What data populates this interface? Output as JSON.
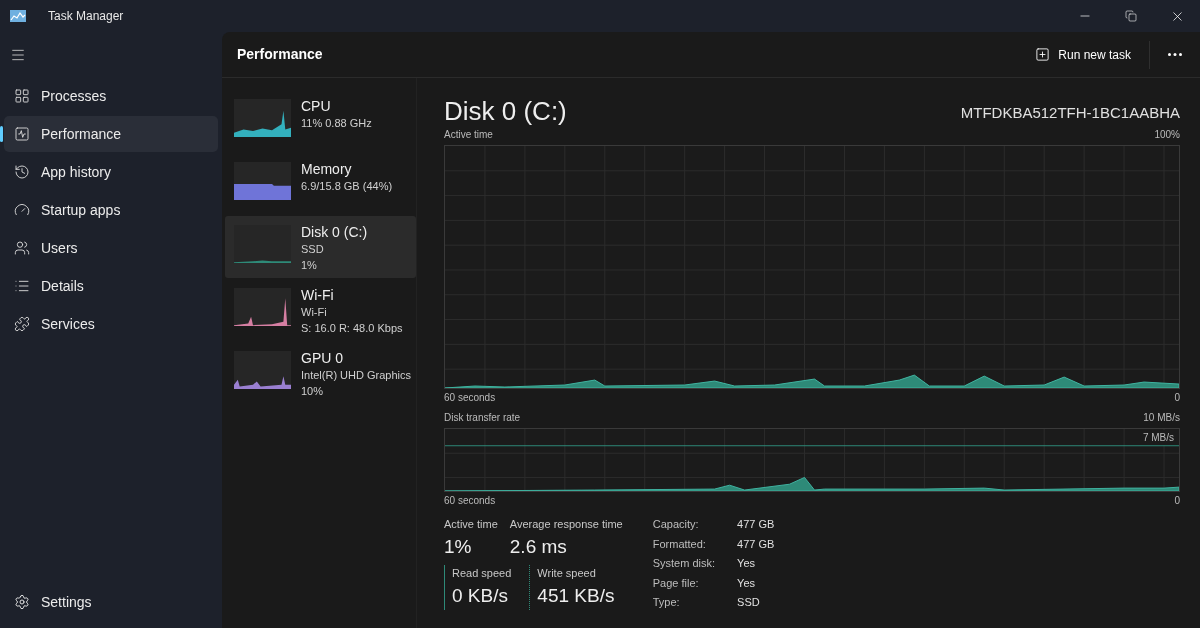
{
  "window": {
    "title": "Task Manager"
  },
  "sidebar": {
    "items": [
      {
        "label": "Processes",
        "selected": false
      },
      {
        "label": "Performance",
        "selected": true
      },
      {
        "label": "App history",
        "selected": false
      },
      {
        "label": "Startup apps",
        "selected": false
      },
      {
        "label": "Users",
        "selected": false
      },
      {
        "label": "Details",
        "selected": false
      },
      {
        "label": "Services",
        "selected": false
      }
    ],
    "footer": {
      "label": "Settings"
    }
  },
  "header": {
    "title": "Performance",
    "run_new_task": "Run new task"
  },
  "devices": [
    {
      "name": "CPU",
      "lines": [
        "11%  0.88 GHz"
      ],
      "color": "#33b0bd",
      "selected": false
    },
    {
      "name": "Memory",
      "lines": [
        "6.9/15.8 GB (44%)"
      ],
      "color": "#6f74d8",
      "selected": false
    },
    {
      "name": "Disk 0 (C:)",
      "lines": [
        "SSD",
        "1%"
      ],
      "color": "#2e8a78",
      "selected": true
    },
    {
      "name": "Wi-Fi",
      "lines": [
        "Wi-Fi",
        "S: 16.0  R: 48.0 Kbps"
      ],
      "color": "#d67fa3",
      "selected": false
    },
    {
      "name": "GPU 0",
      "lines": [
        "Intel(R) UHD Graphics",
        "10%"
      ],
      "color": "#9a7fd1",
      "selected": false
    }
  ],
  "detail": {
    "title": "Disk 0 (C:)",
    "model": "MTFDKBA512TFH-1BC1AABHA",
    "graph1": {
      "label": "Active time",
      "max": "100%",
      "time": "60 seconds",
      "min": "0"
    },
    "graph2": {
      "label": "Disk transfer rate",
      "max": "10 MB/s",
      "inner": "7 MB/s",
      "time": "60 seconds",
      "min": "0"
    },
    "stats": [
      {
        "label": "Active time",
        "value": "1%"
      },
      {
        "label": "Average response time",
        "value": "2.6 ms"
      }
    ],
    "speeds": [
      {
        "label": "Read speed",
        "value": "0 KB/s",
        "kind": "solid"
      },
      {
        "label": "Write speed",
        "value": "451 KB/s",
        "kind": "dotted"
      }
    ],
    "properties": [
      {
        "label": "Capacity:",
        "value": "477 GB"
      },
      {
        "label": "Formatted:",
        "value": "477 GB"
      },
      {
        "label": "System disk:",
        "value": "Yes"
      },
      {
        "label": "Page file:",
        "value": "Yes"
      },
      {
        "label": "Type:",
        "value": "SSD"
      }
    ]
  }
}
